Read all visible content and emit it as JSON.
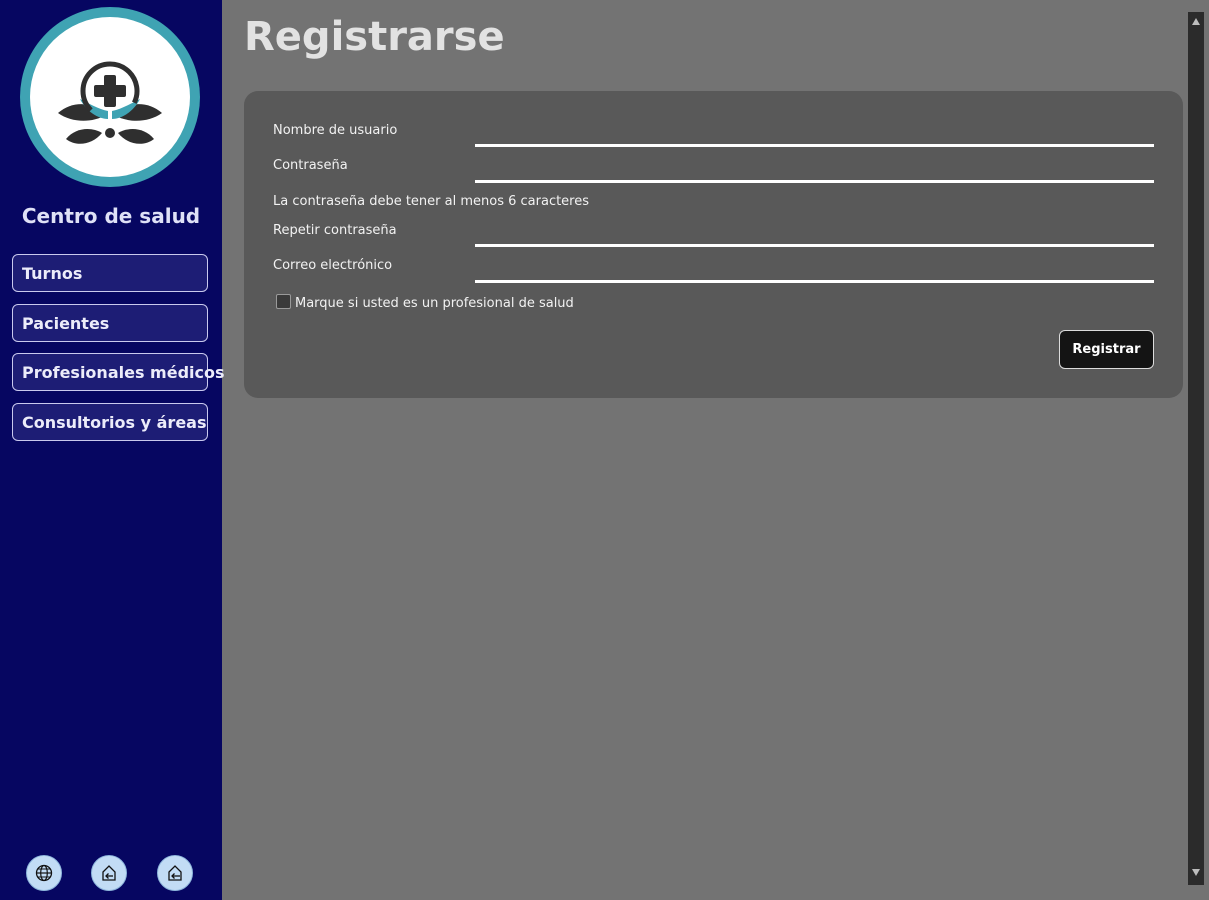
{
  "sidebar": {
    "logo_icon": "medical-cross-hands-leaves-logo",
    "brand": "Centro de salud",
    "items": [
      {
        "label": "Turnos"
      },
      {
        "label": "Pacientes"
      },
      {
        "label": "Profesionales médicos"
      },
      {
        "label": "Consultorios y áreas"
      }
    ],
    "footer_icons": [
      "globe-icon",
      "home-login-icon",
      "home-logout-icon"
    ]
  },
  "page": {
    "title": "Registrarse"
  },
  "form": {
    "username_label": "Nombre de usuario",
    "username_value": "",
    "password_label": "Contraseña",
    "password_value": "",
    "password_hint": "La contraseña debe tener al menos 6 caracteres",
    "repeat_password_label": "Repetir contraseña",
    "repeat_password_value": "",
    "email_label": "Correo electrónico",
    "email_value": "",
    "professional_checkbox_label": "Marque si usted es un profesional de salud",
    "professional_checked": false,
    "submit_label": "Registrar"
  },
  "colors": {
    "sidebar_bg": "#060661",
    "logo_ring": "#3fa3b3",
    "main_bg": "#737373",
    "card_bg": "#595959",
    "submit_bg": "#141414"
  }
}
